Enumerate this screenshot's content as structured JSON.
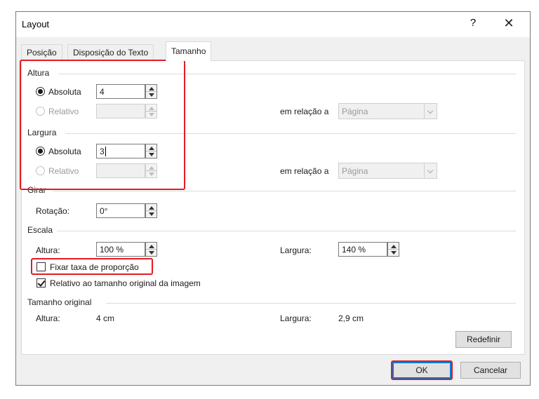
{
  "dialog": {
    "title": "Layout",
    "help_label": "?",
    "close_label": "✕"
  },
  "tabs": [
    {
      "label": "Posição"
    },
    {
      "label": "Disposição do Texto"
    },
    {
      "label": "Tamanho",
      "selected": true
    }
  ],
  "altura": {
    "section_label": "Altura",
    "absoluta_label": "Absoluta",
    "absoluta_value": "4",
    "relativo_label": "Relativo",
    "relativo_value": "",
    "em_relacao_label": "em relação a",
    "em_relacao_value": "Página"
  },
  "largura": {
    "section_label": "Largura",
    "absoluta_label": "Absoluta",
    "absoluta_value": "3",
    "relativo_label": "Relativo",
    "relativo_value": "",
    "em_relacao_label": "em relação a",
    "em_relacao_value": "Página"
  },
  "girar": {
    "section_label": "Girar",
    "rotacao_label": "Rotação:",
    "rotacao_value": "0°"
  },
  "escala": {
    "section_label": "Escala",
    "altura_label": "Altura:",
    "altura_value": "100 %",
    "largura_label": "Largura:",
    "largura_value": "140 %",
    "fixar_label": "Fixar taxa de proporção",
    "fixar_checked": false,
    "relativo_label": "Relativo ao tamanho original da imagem",
    "relativo_checked": true
  },
  "tamanho_original": {
    "section_label": "Tamanho original",
    "altura_label": "Altura:",
    "altura_value": "4 cm",
    "largura_label": "Largura:",
    "largura_value": "2,9 cm"
  },
  "buttons": {
    "redefinir": "Redefinir",
    "ok": "OK",
    "cancelar": "Cancelar"
  },
  "colors": {
    "highlight_red": "#e31b23",
    "focus_blue": "#0078d7"
  }
}
